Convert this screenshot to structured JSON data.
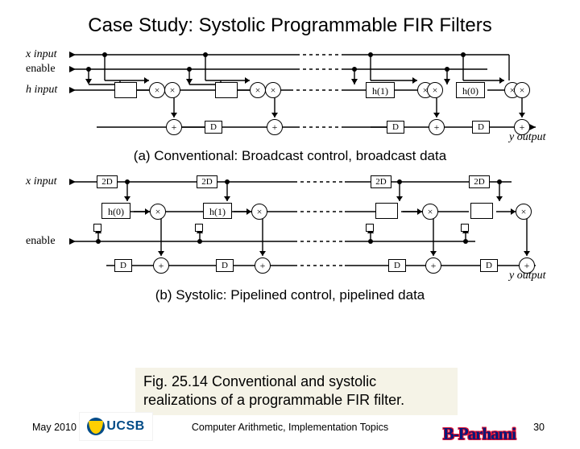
{
  "title": "Case Study: Systolic Programmable FIR Filters",
  "caption_a": "(a) Conventional: Broadcast control, broadcast data",
  "caption_b": "(b) Systolic: Pipelined control, pipelined data",
  "fig_caption": "Fig. 25.14    Conventional and systolic realizations of a programmable FIR filter.",
  "footer": {
    "date": "May 2010",
    "center": "Computer Arithmetic, Implementation Topics",
    "page": "30"
  },
  "labels": {
    "x_input": "x input",
    "enable": "enable",
    "h_input": "h input",
    "y_output": "y output",
    "D": "D",
    "D2": "2D",
    "plus": "+",
    "times": "×",
    "h0": "h(0)",
    "h1": "h(1)"
  },
  "logos": {
    "ucsb": "UCSB",
    "author": "B-Parhami"
  }
}
